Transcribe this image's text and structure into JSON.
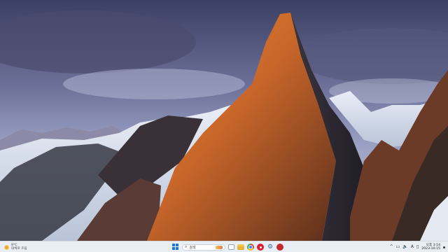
{
  "desktop": {
    "wallpaper": "mountain-peak-sunset-wallpaper"
  },
  "taskbar": {
    "weather": {
      "temp": "9°C",
      "desc": "대체로 흐림"
    },
    "search": {
      "label": "검색"
    },
    "pinned_apps": [
      "task-view",
      "file-explorer",
      "chrome",
      "red-app",
      "settings",
      "game-app"
    ],
    "tray": {
      "chevron": "^",
      "ime": "A"
    },
    "clock": {
      "time": "오후 3:14",
      "date": "2023-10-15"
    }
  },
  "colors": {
    "taskbar_bg": "#e9edf4",
    "start_blue": "#1c74d8"
  }
}
